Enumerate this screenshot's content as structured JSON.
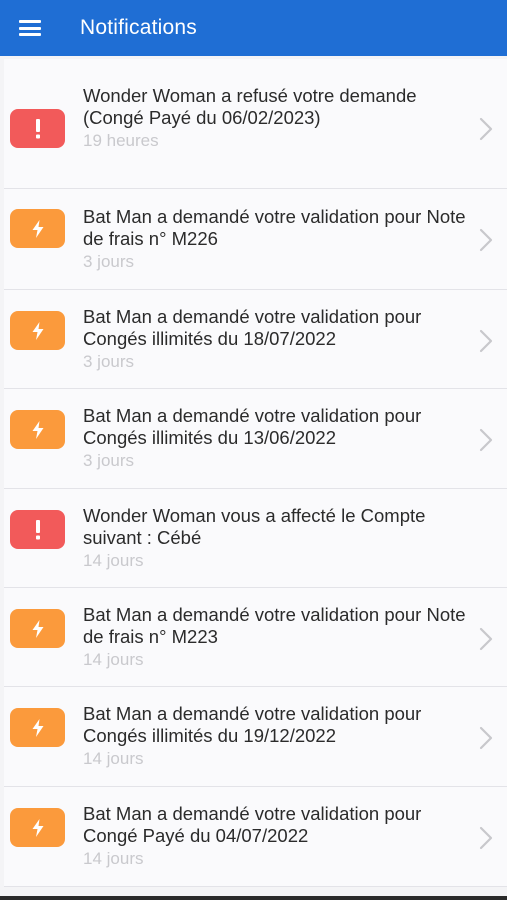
{
  "appbar": {
    "title": "Notifications",
    "menu_icon": "hamburger-menu-icon",
    "color": "#1f6ed4"
  },
  "notifications": [
    {
      "type": "error",
      "icon": "exclamation-icon",
      "message": "Wonder Woman a refusé votre demande (Congé Payé du 06/02/2023)",
      "time": "19 heures",
      "has_chevron": true
    },
    {
      "type": "flash",
      "icon": "lightning-icon",
      "message": "Bat Man a demandé votre validation pour Note de frais n° M226",
      "time": "3 jours",
      "has_chevron": true
    },
    {
      "type": "flash",
      "icon": "lightning-icon",
      "message": "Bat Man a demandé votre validation pour Congés illimités du 18/07/2022",
      "time": "3 jours",
      "has_chevron": true
    },
    {
      "type": "flash",
      "icon": "lightning-icon",
      "message": "Bat Man a demandé votre validation pour Congés illimités du 13/06/2022",
      "time": "3 jours",
      "has_chevron": true
    },
    {
      "type": "error",
      "icon": "exclamation-icon",
      "message": "Wonder Woman vous a affecté le Compte suivant : Cébé",
      "time": "14 jours",
      "has_chevron": false
    },
    {
      "type": "flash",
      "icon": "lightning-icon",
      "message": "Bat Man a demandé votre validation pour Note de frais n° M223",
      "time": "14 jours",
      "has_chevron": true
    },
    {
      "type": "flash",
      "icon": "lightning-icon",
      "message": "Bat Man a demandé votre validation pour Congés illimités du 19/12/2022",
      "time": "14 jours",
      "has_chevron": true
    },
    {
      "type": "flash",
      "icon": "lightning-icon",
      "message": "Bat Man a demandé votre validation pour Congé Payé du 04/07/2022",
      "time": "14 jours",
      "has_chevron": true
    }
  ],
  "colors": {
    "error": "#f25a5a",
    "flash": "#fb9a3c",
    "time_text": "#c9c9cd"
  }
}
